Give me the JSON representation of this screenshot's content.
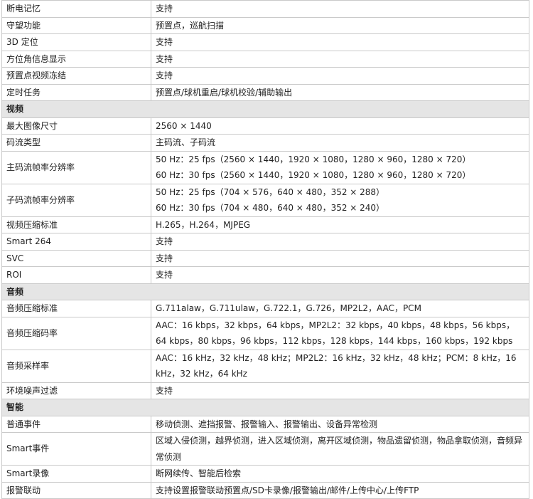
{
  "rows": [
    {
      "type": "row",
      "label": "断电记忆",
      "values": [
        "支持"
      ]
    },
    {
      "type": "row",
      "label": "守望功能",
      "values": [
        "预置点，巡航扫描"
      ]
    },
    {
      "type": "row",
      "label": "3D 定位",
      "values": [
        "支持"
      ]
    },
    {
      "type": "row",
      "label": "方位角信息显示",
      "values": [
        "支持"
      ]
    },
    {
      "type": "row",
      "label": "预置点视频冻结",
      "values": [
        "支持"
      ]
    },
    {
      "type": "row",
      "label": "定时任务",
      "values": [
        "预置点/球机重启/球机校验/辅助输出"
      ]
    },
    {
      "type": "section",
      "label": "视频"
    },
    {
      "type": "row",
      "label": "最大图像尺寸",
      "values": [
        "2560 × 1440"
      ]
    },
    {
      "type": "row",
      "label": "码流类型",
      "values": [
        "主码流、子码流"
      ]
    },
    {
      "type": "row",
      "label": "主码流帧率分辨率",
      "values": [
        "50 Hz：25 fps（2560 × 1440，1920 × 1080，1280 × 960，1280 × 720）",
        "60 Hz：30 fps（2560 × 1440，1920 × 1080，1280 × 960，1280 × 720）"
      ]
    },
    {
      "type": "row",
      "label": "子码流帧率分辨率",
      "values": [
        "50 Hz：25 fps（704 × 576，640 × 480，352 × 288）",
        "60 Hz：30 fps（704 × 480，640 × 480，352 × 240）"
      ]
    },
    {
      "type": "row",
      "label": "视频压缩标准",
      "values": [
        "H.265，H.264，MJPEG"
      ]
    },
    {
      "type": "row",
      "label": "Smart 264",
      "values": [
        "支持"
      ]
    },
    {
      "type": "row",
      "label": "SVC",
      "values": [
        "支持"
      ]
    },
    {
      "type": "row",
      "label": "ROI",
      "values": [
        "支持"
      ]
    },
    {
      "type": "section",
      "label": "音频"
    },
    {
      "type": "row",
      "label": "音频压缩标准",
      "values": [
        "G.711alaw，G.711ulaw，G.722.1，G.726，MP2L2，AAC，PCM"
      ]
    },
    {
      "type": "row",
      "label": "音频压缩码率",
      "wrap": true,
      "values": [
        "AAC：16 kbps，32 kbps，64 kbps，MP2L2：32 kbps，40 kbps，48 kbps，56 kbps，64 kbps，80 kbps，96 kbps，112 kbps，128 kbps，144 kbps，160 kbps，192 kbps"
      ]
    },
    {
      "type": "row",
      "label": "音频采样率",
      "wrap": true,
      "values": [
        "AAC：16 kHz，32 kHz，48 kHz；MP2L2：16 kHz，32 kHz，48 kHz；PCM：8 kHz，16 kHz，32 kHz，64 kHz"
      ]
    },
    {
      "type": "row",
      "label": "环境噪声过滤",
      "values": [
        "支持"
      ]
    },
    {
      "type": "section",
      "label": "智能"
    },
    {
      "type": "row",
      "label": "普通事件",
      "values": [
        "移动侦测、遮挡报警、报警输入、报警输出、设备异常检测"
      ]
    },
    {
      "type": "row",
      "label": "Smart事件",
      "wrap": true,
      "values": [
        "区域入侵侦测，越界侦测，进入区域侦测，离开区域侦测，物品遗留侦测，物品拿取侦测，音频异常侦测"
      ]
    },
    {
      "type": "row",
      "label": "Smart录像",
      "values": [
        "断网续传、智能后检索"
      ]
    },
    {
      "type": "row",
      "label": "报警联动",
      "values": [
        "支持设置报警联动预置点/SD卡录像/报警输出/邮件/上传中心/上传FTP"
      ]
    }
  ]
}
